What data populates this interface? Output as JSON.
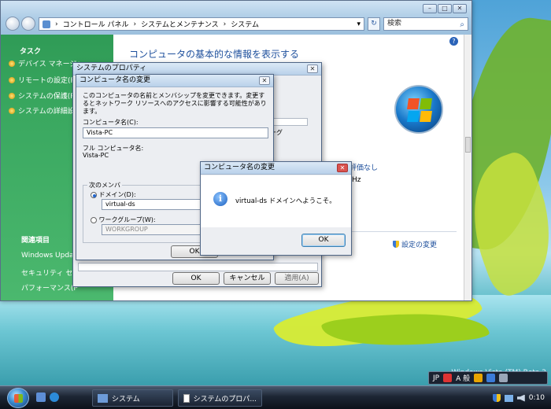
{
  "explorer": {
    "address": [
      "コントロール パネル",
      "システムとメンテナンス",
      "システム"
    ],
    "search_placeholder": "検索",
    "title": "コンピュータの基本的な情報を表示する",
    "sidebar": {
      "heading": "タスク",
      "tasks": [
        "デバイス マネージャ",
        "リモートの設定(R)",
        "システムの保護(P)",
        "システムの詳細設定"
      ],
      "related_heading": "関連項目",
      "related": [
        "Windows Update",
        "セキュリティ セン",
        "パフォーマンス(P"
      ]
    },
    "rating": "評価なし",
    "hz": "Hz",
    "change_settings": "設定の変更"
  },
  "sysprops": {
    "title": "システムのプロパティ",
    "ok": "OK",
    "cancel": "キャンセル",
    "apply": "適用(A)",
    "partial_label": "ーグ",
    "ok_small": "OK"
  },
  "rename_dialog": {
    "title": "コンピュータ名の変更",
    "description": "このコンピュータの名前とメンバシップを変更できます。変更するとネットワーク リソースへのアクセスに影響する可能性があります。",
    "computer_name_label": "コンピュータ名(C):",
    "computer_name_value": "Vista-PC",
    "full_name_label": "フル コンピュータ名:",
    "full_name_value": "Vista-PC",
    "member_label": "次のメンバ",
    "domain_label": "ドメイン(D):",
    "domain_value": "virtual-ds",
    "workgroup_label": "ワークグループ(W):",
    "workgroup_value": "WORKGROUP"
  },
  "message_box": {
    "title": "コンピュータ名の変更",
    "message": "virtual-ds ドメインへようこそ。",
    "ok": "OK"
  },
  "taskbar": {
    "buttons": [
      "システム",
      "システムのプロパ..."
    ],
    "clock": "0:10",
    "watermark": "Windows Vista (TM) Beta 2",
    "lang": "JP",
    "ime_mode": "A 般"
  },
  "colors": {
    "sidebar": "#3aa860",
    "link": "#1d4f9c",
    "accent": "#2a63b8"
  }
}
